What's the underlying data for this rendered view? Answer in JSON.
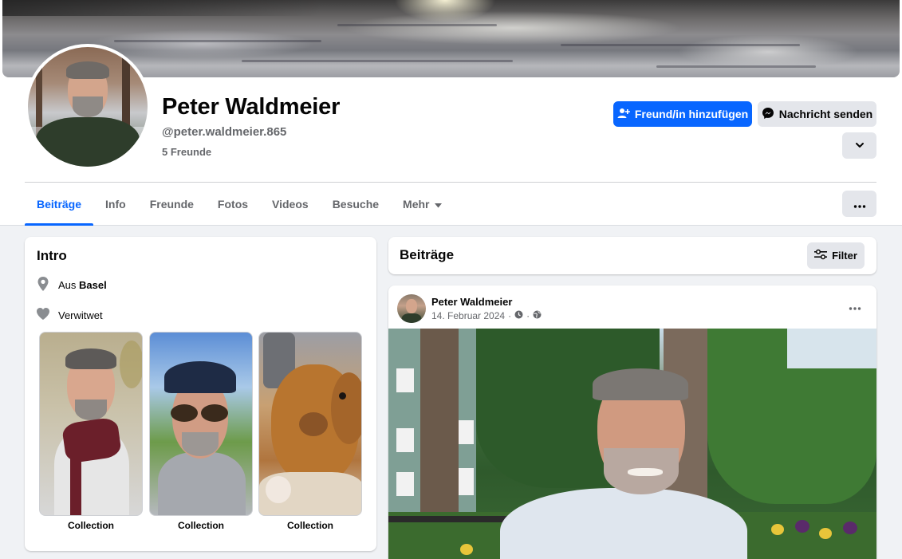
{
  "profile": {
    "name": "Peter Waldmeier",
    "handle": "@peter.waldmeier.865",
    "friends": "5 Freunde"
  },
  "actions": {
    "add_friend": "Freund/in hinzufügen",
    "message": "Nachricht senden"
  },
  "tabs": [
    {
      "label": "Beiträge",
      "active": true
    },
    {
      "label": "Info"
    },
    {
      "label": "Freunde"
    },
    {
      "label": "Fotos"
    },
    {
      "label": "Videos"
    },
    {
      "label": "Besuche"
    },
    {
      "label": "Mehr"
    }
  ],
  "intro": {
    "title": "Intro",
    "location_prefix": "Aus",
    "location": "Basel",
    "relationship": "Verwitwet",
    "featured": [
      {
        "label": "Collection"
      },
      {
        "label": "Collection"
      },
      {
        "label": "Collection"
      }
    ]
  },
  "posts_header": {
    "title": "Beiträge",
    "filter_label": "Filter"
  },
  "post": {
    "author": "Peter Waldmeier",
    "date": "14. Februar 2024",
    "separator": "·"
  },
  "colors": {
    "accent": "#0866ff",
    "secondary_button": "#e4e6eb",
    "muted_text": "#65676b",
    "page_bg": "#f0f2f5"
  },
  "icons": [
    "add-friend-icon",
    "messenger-icon",
    "chevron-down-icon",
    "more-dots-icon",
    "caret-down-icon",
    "location-pin-icon",
    "heart-icon",
    "filter-icon",
    "clock-icon",
    "globe-icon"
  ]
}
